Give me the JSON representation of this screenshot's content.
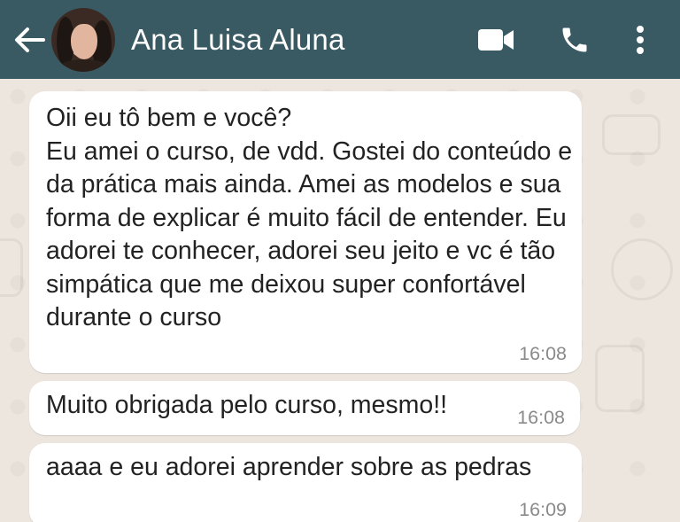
{
  "header": {
    "contact_name": "Ana Luisa Aluna",
    "background_color": "#3a5a63",
    "icons": [
      "back-arrow-icon",
      "video-call-icon",
      "phone-icon",
      "more-options-icon"
    ]
  },
  "messages": [
    {
      "text": "Oii eu tô bem e você?\nEu amei o curso, de vdd. Gostei do conteúdo e da prática mais ainda. Amei as modelos e sua forma de explicar é muito fácil de entender. Eu adorei te conhecer, adorei seu jeito e vc é tão simpática que me deixou super confortável durante o curso",
      "time": "16:08"
    },
    {
      "text": "Muito obrigada pelo curso, mesmo!!",
      "time": "16:08"
    },
    {
      "text": "aaaa e eu adorei aprender sobre as pedras",
      "time": "16:09"
    }
  ]
}
